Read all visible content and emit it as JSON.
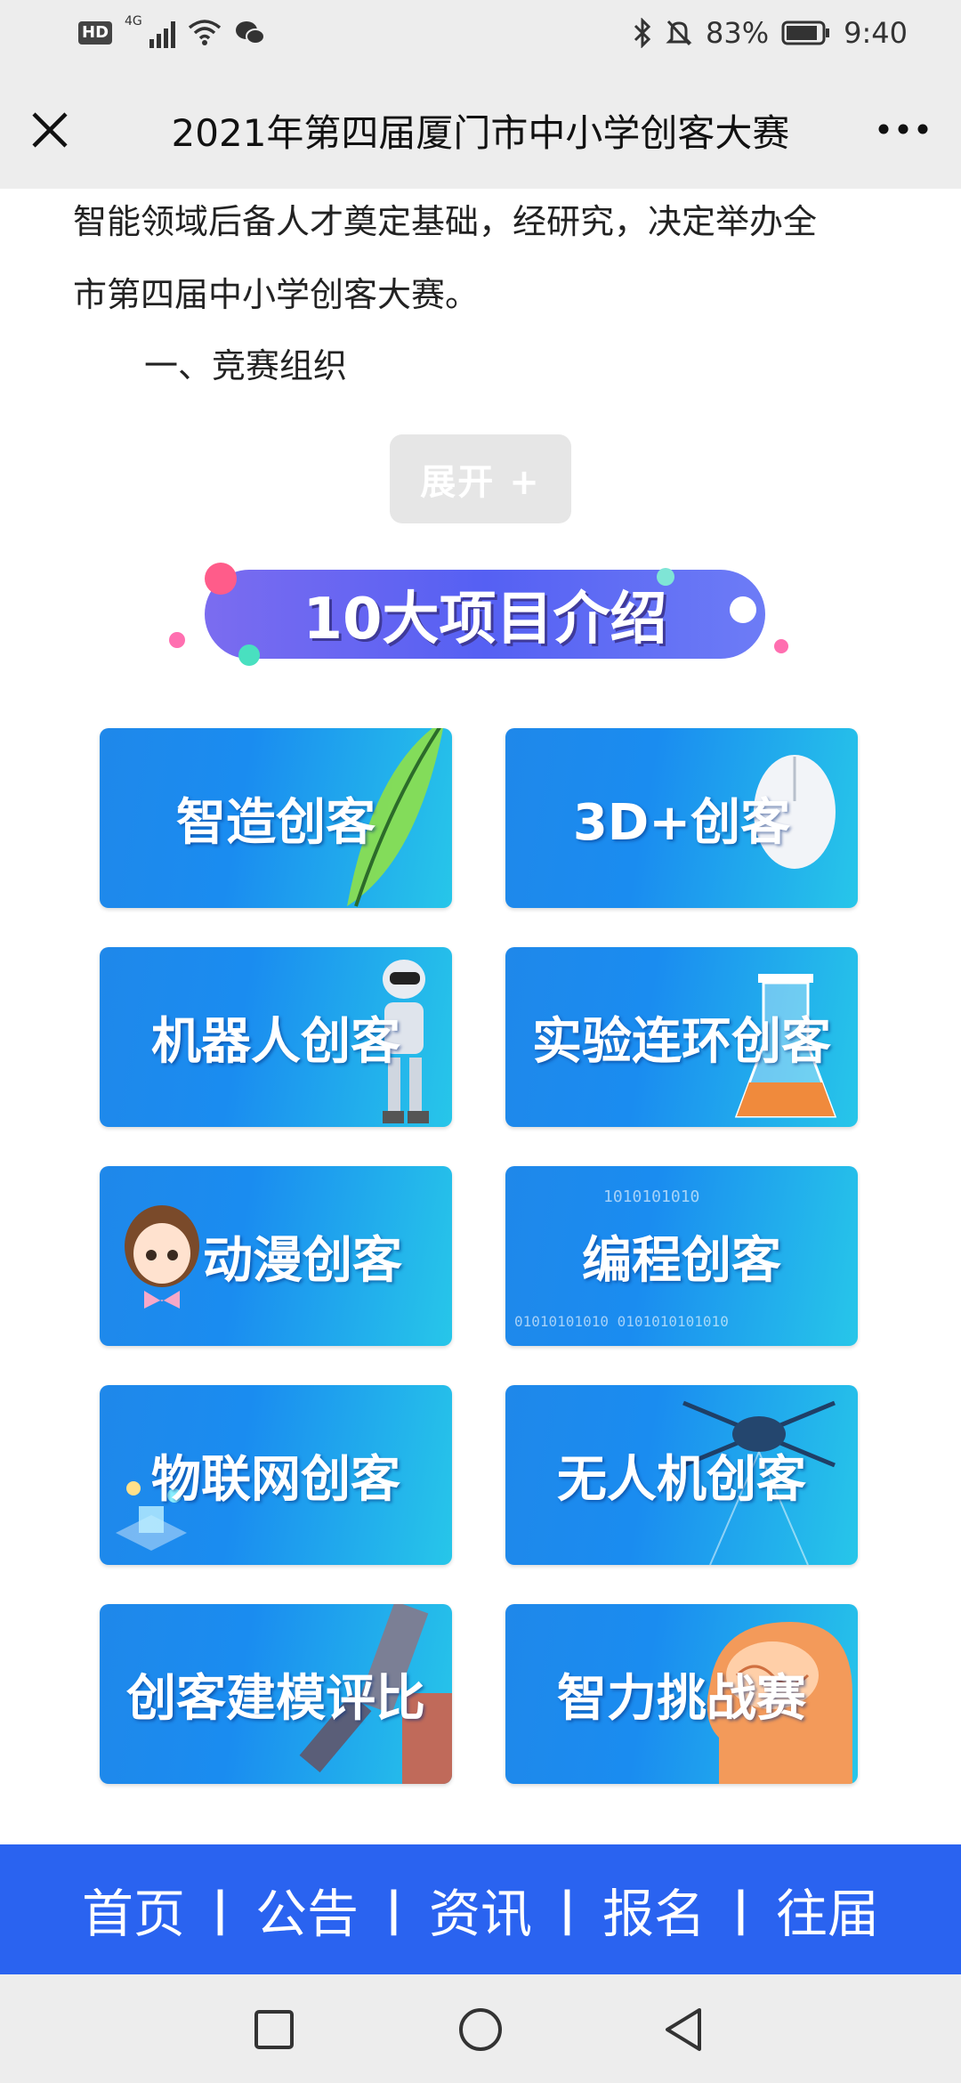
{
  "status": {
    "hd": "HD",
    "network": "4G",
    "battery": "83%",
    "time": "9:40"
  },
  "header": {
    "title": "2021年第四届厦门市中小学创客大赛"
  },
  "article": {
    "line1": "智能领域后备人才奠定基础，经研究，决定举办全",
    "line2": "市第四届中小学创客大赛。",
    "line3": "一、竞赛组织",
    "expand_label": "展开 +"
  },
  "banner": {
    "title": "10大项目介绍"
  },
  "projects": [
    {
      "label": "智造创客",
      "icon": "feather-icon"
    },
    {
      "label": "3D+创客",
      "icon": "mouse-icon"
    },
    {
      "label": "机器人创客",
      "icon": "robot-icon"
    },
    {
      "label": "实验连环创客",
      "icon": "beaker-icon"
    },
    {
      "label": "动漫创客",
      "icon": "anime-girl-icon"
    },
    {
      "label": "编程创客",
      "icon": "binary-code-icon"
    },
    {
      "label": "物联网创客",
      "icon": "iot-icon"
    },
    {
      "label": "无人机创客",
      "icon": "drone-icon"
    },
    {
      "label": "创客建模评比",
      "icon": "robotic-arm-icon"
    },
    {
      "label": "智力挑战赛",
      "icon": "brain-icon"
    }
  ],
  "bottom_nav": {
    "items": [
      "首页",
      "公告",
      "资讯",
      "报名",
      "往届"
    ],
    "separator": "|"
  },
  "colors": {
    "nav_blue": "#2a63f0",
    "tile_blue": "#1f88ea",
    "tile_cyan": "#27c6e9",
    "banner_purple": "#6d6cf3"
  }
}
